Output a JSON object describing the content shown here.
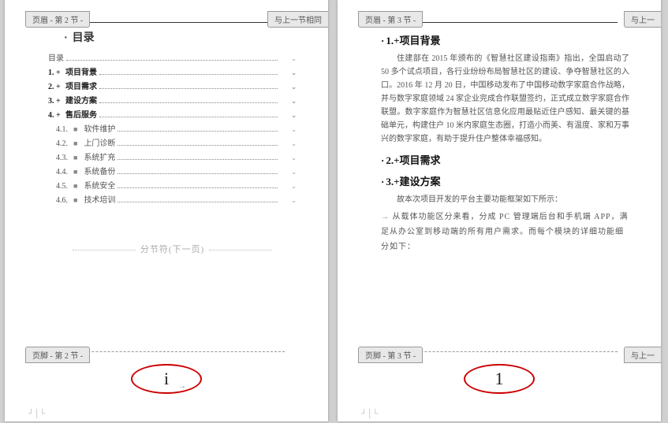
{
  "page1": {
    "header_tab_left": "页眉 - 第 2 节 -",
    "header_tab_right": "与上一节相同",
    "title": "目录",
    "toc": {
      "intro": "目录",
      "main_items": [
        {
          "num": "1. +",
          "label": "项目背景"
        },
        {
          "num": "2. +",
          "label": "项目需求"
        },
        {
          "num": "3. +",
          "label": "建设方案"
        },
        {
          "num": "4. +",
          "label": "售后服务"
        }
      ],
      "sub_items": [
        {
          "num": "4.1.",
          "label": "软件维护"
        },
        {
          "num": "4.2.",
          "label": "上门诊断"
        },
        {
          "num": "4.3.",
          "label": "系统扩充"
        },
        {
          "num": "4.4.",
          "label": "系统备份"
        },
        {
          "num": "4.5.",
          "label": "系统安全"
        },
        {
          "num": "4.6.",
          "label": "技术培训"
        }
      ]
    },
    "section_break": "分节符(下一页)",
    "footer_tab_left": "页脚 - 第 2 节 -",
    "page_number": "i"
  },
  "page2": {
    "header_tab_left": "页眉 - 第 3 节 -",
    "header_tab_right": "与上一",
    "h1": "1.+项目背景",
    "para1": "住建部在 2015 年颁布的《智慧社区建设指南》指出，全国启动了 50 多个试点项目，各行业纷纷布局智慧社区的建设、争夺智慧社区的入口。2016 年 12 月 20 日，中国移动发布了中国移动数字家庭合作战略，并与数字家庭领域 24 家企业完成合作联盟签约，正式成立数字家庭合作联盟。数字家庭作为智慧社区信息化应用最贴近住户感知、最关键的基础单元，构建住户 10 米内家庭生态圈，打造小而美、有温度、家和万事兴的数字家庭，有助于提升住户整体幸福感知。",
    "h2": "2.+项目需求",
    "h3": "3.+建设方案",
    "para2": "故本次项目开发的平台主要功能框架如下所示：",
    "bullet1": "从载体功能区分来看，分成 PC 管理端后台和手机端 APP，满足从办公室到移动端的所有用户需求。而每个模块的详细功能细分如下：",
    "footer_tab_left": "页脚 - 第 3 节 -",
    "footer_tab_right": "与上一",
    "page_number": "1"
  }
}
